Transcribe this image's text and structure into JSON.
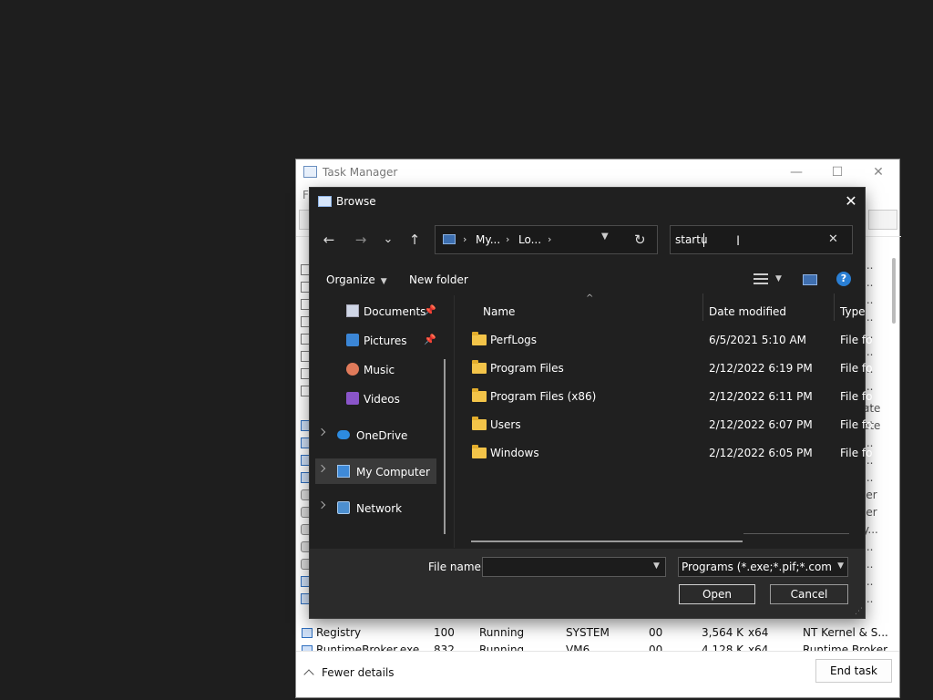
{
  "task_manager": {
    "title": "Task Manager",
    "menu_fragment": "F",
    "window_controls": {
      "minimize": "—",
      "maximize": "☐",
      "close": "✕"
    },
    "right_fragments": [
      "...",
      "...",
      "...",
      "...",
      "...",
      "...",
      "...",
      "...",
      "...",
      "ate",
      "ate",
      "...",
      "...",
      "...",
      "ler",
      "ler",
      "y...",
      "...",
      "...",
      "...",
      "...",
      "..."
    ],
    "processes": [
      {
        "name": "Registry",
        "pid": "100",
        "status": "Running",
        "user": "SYSTEM",
        "cpu": "00",
        "memory": "3,564 K",
        "arch": "x64",
        "description": "NT Kernel & S..."
      },
      {
        "name": "RuntimeBroker.exe",
        "pid": "832",
        "status": "Running",
        "user": "VM6",
        "cpu": "00",
        "memory": "4,128 K",
        "arch": "x64",
        "description": "Runtime Broker"
      }
    ],
    "fewer_details_label": "Fewer details",
    "end_task_label": "End task"
  },
  "browse": {
    "title": "Browse",
    "close": "✕",
    "nav": {
      "back": "←",
      "forward": "→",
      "recent": "⌄",
      "up": "↑"
    },
    "breadcrumb": [
      "My...",
      "Lo..."
    ],
    "crumb_separator": "›",
    "search_value": "startu",
    "search_clear": "✕",
    "toolbar": {
      "organize_label": "Organize",
      "new_folder_label": "New folder",
      "help": "?"
    },
    "nav_pane": {
      "quick_access": [
        {
          "label": "Documents",
          "pinned": true
        },
        {
          "label": "Pictures",
          "pinned": true
        },
        {
          "label": "Music",
          "pinned": false
        },
        {
          "label": "Videos",
          "pinned": false
        }
      ],
      "pin_glyph": "📌",
      "roots": [
        {
          "label": "OneDrive"
        },
        {
          "label": "My Computer",
          "selected": true
        },
        {
          "label": "Network"
        }
      ]
    },
    "columns": {
      "name": "Name",
      "date_modified": "Date modified",
      "type": "Type"
    },
    "files": [
      {
        "name": "PerfLogs",
        "date": "6/5/2021 5:10 AM",
        "type": "File fo"
      },
      {
        "name": "Program Files",
        "date": "2/12/2022 6:19 PM",
        "type": "File fo"
      },
      {
        "name": "Program Files (x86)",
        "date": "2/12/2022 6:11 PM",
        "type": "File fo"
      },
      {
        "name": "Users",
        "date": "2/12/2022 6:07 PM",
        "type": "File fo"
      },
      {
        "name": "Windows",
        "date": "2/12/2022 6:05 PM",
        "type": "File fo"
      }
    ],
    "file_name_label": "File name:",
    "file_name_value": "",
    "file_type_value": "Programs (*.exe;*.pif;*.com;*.bat;*.cmd)",
    "open_label": "Open",
    "cancel_label": "Cancel"
  },
  "colors": {
    "dialog_bg": "#202020",
    "accent": "#2a7fd4",
    "folder": "#f3c449"
  }
}
